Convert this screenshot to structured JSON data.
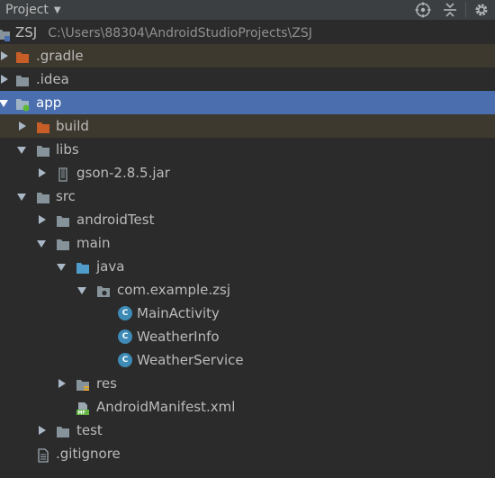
{
  "toolbar": {
    "title": "Project",
    "icons": [
      "target-icon",
      "collapse-icon",
      "gear-icon"
    ]
  },
  "tree": {
    "root": {
      "name": "ZSJ",
      "path": "C:\\Users\\88304\\AndroidStudioProjects\\ZSJ"
    },
    "items": [
      {
        "label": ".gradle"
      },
      {
        "label": ".idea"
      },
      {
        "label": "app"
      },
      {
        "label": "build"
      },
      {
        "label": "libs"
      },
      {
        "label": "gson-2.8.5.jar"
      },
      {
        "label": "src"
      },
      {
        "label": "androidTest"
      },
      {
        "label": "main"
      },
      {
        "label": "java"
      },
      {
        "label": "com.example.zsj"
      },
      {
        "label": "MainActivity"
      },
      {
        "label": "WeatherInfo"
      },
      {
        "label": "WeatherService"
      },
      {
        "label": "res"
      },
      {
        "label": "AndroidManifest.xml"
      },
      {
        "label": "test"
      },
      {
        "label": ".gitignore"
      }
    ]
  },
  "colors": {
    "background": "#2b2b2b",
    "selection": "#4b6eaf",
    "excluded_row": "#3e392f",
    "excluded_folder": "#c75d27",
    "folder": "#87939a",
    "source_folder": "#4f9bc9",
    "class_badge": "#3d8bb6"
  }
}
